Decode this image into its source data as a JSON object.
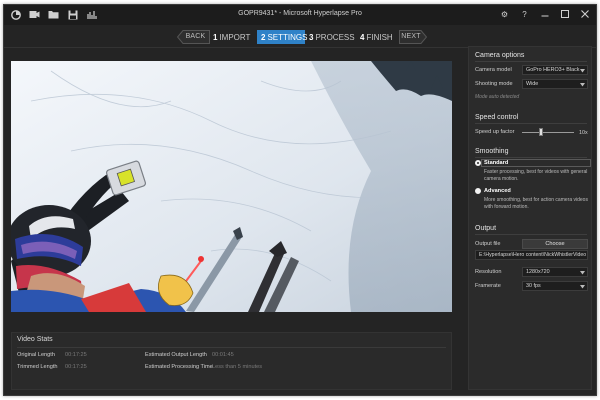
{
  "window": {
    "title": "GOPR9431* - Microsoft Hyperlapse Pro"
  },
  "titlebar": {
    "left_icons": [
      "app-logo-icon",
      "folder-icon",
      "save-icon",
      "export-icon"
    ],
    "settings_glyph": "⚙",
    "help_glyph": "?",
    "minimize_glyph": "—",
    "maximize_glyph": "☐",
    "close_glyph": "✕"
  },
  "nav": {
    "back_label": "BACK",
    "next_label": "NEXT",
    "steps": [
      {
        "num": "1",
        "label": "IMPORT",
        "active": false
      },
      {
        "num": "2",
        "label": "SETTINGS",
        "active": true
      },
      {
        "num": "3",
        "label": "PROCESS",
        "active": false
      },
      {
        "num": "4",
        "label": "FINISH",
        "active": false
      }
    ],
    "accent_color": "#2f82c8"
  },
  "video_stats": {
    "title": "Video Stats",
    "original_length_label": "Original Length",
    "original_length_value": "00:17:25",
    "trimmed_length_label": "Trimmed Length",
    "trimmed_length_value": "00:17:25",
    "estimated_output_length_label": "Estimated Output Length",
    "estimated_output_length_value": "00:01:45",
    "estimated_processing_time_label": "Estimated Processing Time",
    "estimated_processing_time_value": "Less than 5 minutes"
  },
  "camera_options": {
    "title": "Camera options",
    "model_label": "Camera model",
    "model_value": "GoPro HERO3+ Black",
    "mode_label": "Shooting mode",
    "mode_value": "Wide",
    "auto_detected": "Mode auto detected"
  },
  "speed_control": {
    "title": "Speed control",
    "label": "Speed up factor",
    "value": "10x",
    "slider_fraction": 0.37
  },
  "smoothing": {
    "title": "Smoothing",
    "standard_title": "Standard",
    "standard_desc": "Faster processing, best for videos with general camera motion.",
    "advanced_title": "Advanced",
    "advanced_desc": "More smoothing, best for action camera videos with forward motion.",
    "selected": "Standard"
  },
  "output": {
    "title": "Output",
    "file_label": "Output file",
    "choose_label": "Choose",
    "path_value": "E:\\Hyperlapse\\Hero content\\NickWhistlerVideo",
    "resolution_label": "Resolution",
    "resolution_value": "1280x720",
    "framerate_label": "Framerate",
    "framerate_value": "30 fps"
  }
}
